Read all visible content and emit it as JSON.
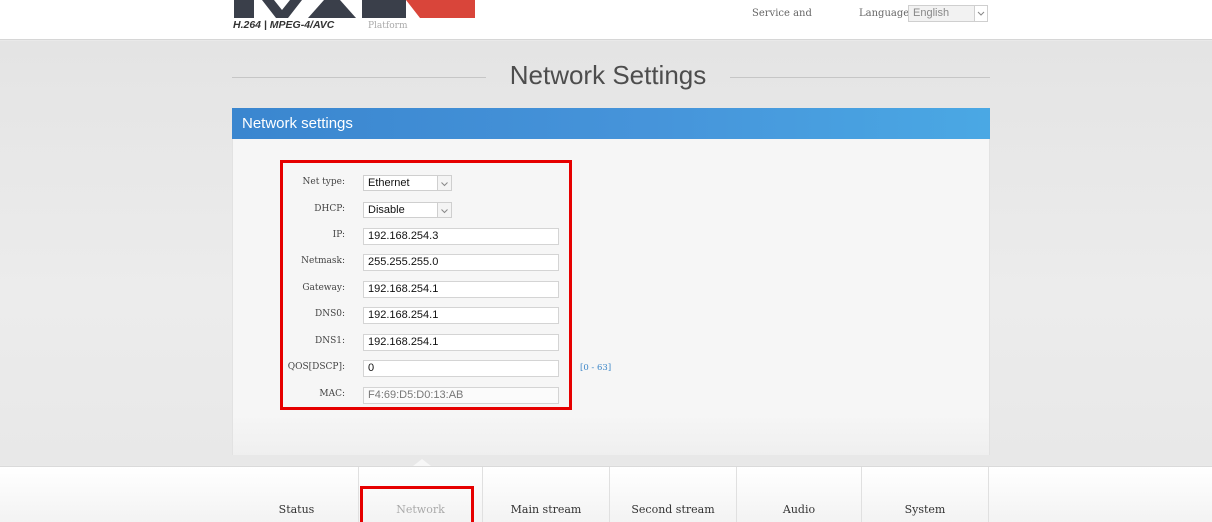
{
  "header": {
    "logo_caption": "H.264 | MPEG-4/AVC",
    "platform_label": "Platform",
    "service_link": "Service and",
    "language_label": "Language:",
    "language_value": "English",
    "logo_icon": "brand-logo-icon"
  },
  "page": {
    "title": "Network Settings"
  },
  "panel": {
    "title": "Network settings",
    "header_color": "#4694da"
  },
  "form": {
    "net_type": {
      "label": "Net type:",
      "value": "Ethernet"
    },
    "dhcp": {
      "label": "DHCP:",
      "value": "Disable"
    },
    "ip": {
      "label": "IP:",
      "value": "192.168.254.3"
    },
    "netmask": {
      "label": "Netmask:",
      "value": "255.255.255.0"
    },
    "gateway": {
      "label": "Gateway:",
      "value": "192.168.254.1"
    },
    "dns0": {
      "label": "DNS0:",
      "value": "192.168.254.1"
    },
    "dns1": {
      "label": "DNS1:",
      "value": "192.168.254.1"
    },
    "qos": {
      "label": "QOS[DSCP]:",
      "value": "0",
      "range": "[0 - 63]"
    },
    "mac": {
      "label": "MAC:",
      "value": "F4:69:D5:D0:13:AB"
    }
  },
  "tabs": {
    "status": "Status",
    "network": "Network",
    "main_stream": "Main stream",
    "second_stream": "Second stream",
    "audio": "Audio",
    "system": "System",
    "active": "Network"
  },
  "colors": {
    "highlight": "#e60000",
    "accent": "#3b86c8"
  }
}
